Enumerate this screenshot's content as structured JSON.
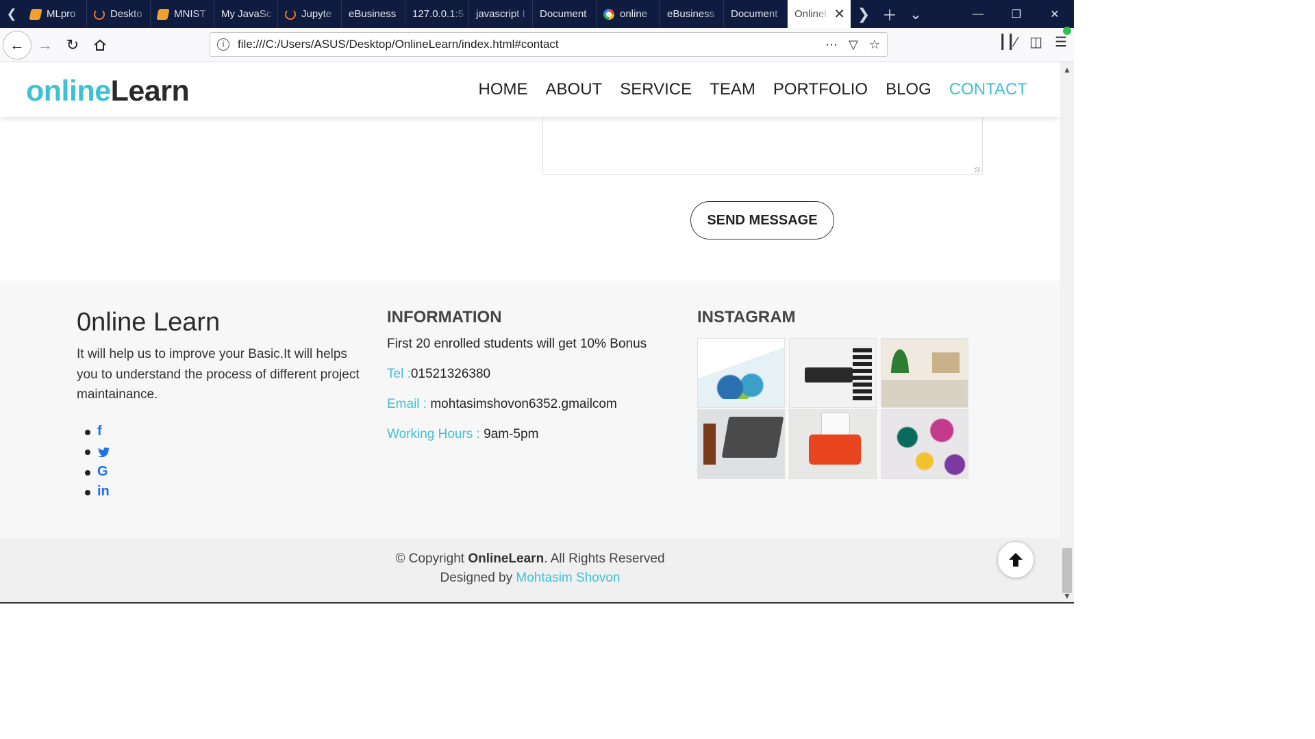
{
  "browser": {
    "tabs": [
      {
        "label": "MLpro",
        "icon": "book-icon"
      },
      {
        "label": "Deskto",
        "icon": "jupyter-icon"
      },
      {
        "label": "MNIST",
        "icon": "book-icon"
      },
      {
        "label": "My JavaSc",
        "icon": ""
      },
      {
        "label": "Jupyte",
        "icon": "jupyter-icon"
      },
      {
        "label": "eBusiness",
        "icon": ""
      },
      {
        "label": "127.0.0.1:5",
        "icon": ""
      },
      {
        "label": "javascript I",
        "icon": ""
      },
      {
        "label": "Document",
        "icon": ""
      },
      {
        "label": "online",
        "icon": "google-icon"
      },
      {
        "label": "eBusiness",
        "icon": ""
      },
      {
        "label": "Document",
        "icon": ""
      }
    ],
    "active_tab": "Onlinel",
    "url": "file:///C:/Users/ASUS/Desktop/OnlineLearn/index.html#contact"
  },
  "site": {
    "logo_part1": "online",
    "logo_part2": "Learn",
    "menu": [
      "HOME",
      "ABOUT",
      "SERVICE",
      "TEAM",
      "PORTFOLIO",
      "BLOG",
      "CONTACT"
    ],
    "active_menu": "CONTACT",
    "accent_color": "#3ec1d3"
  },
  "contact": {
    "send_label": "SEND MESSAGE"
  },
  "footer": {
    "about_title": "0nline Learn",
    "about_text": "It will help us to improve your Basic.It will helps you to understand the process of different project maintainance.",
    "social_icons": [
      "facebook-icon",
      "twitter-icon",
      "google-icon",
      "linkedin-icon"
    ],
    "info_heading": "INFORMATION",
    "info_bonus": "First 20 enrolled students will get 10% Bonus",
    "tel_label": "Tel :",
    "tel_value": "01521326380",
    "email_label": "Email : ",
    "email_value": "mohtasimshovon6352.gmailcom",
    "hours_label": "Working Hours : ",
    "hours_value": "9am-5pm",
    "instagram_heading": "INSTAGRAM"
  },
  "copyright": {
    "prefix": "© Copyright ",
    "brand": "OnlineLearn",
    "suffix": ". All Rights Reserved",
    "designed_prefix": "Designed by ",
    "author": "Mohtasim Shovon"
  }
}
